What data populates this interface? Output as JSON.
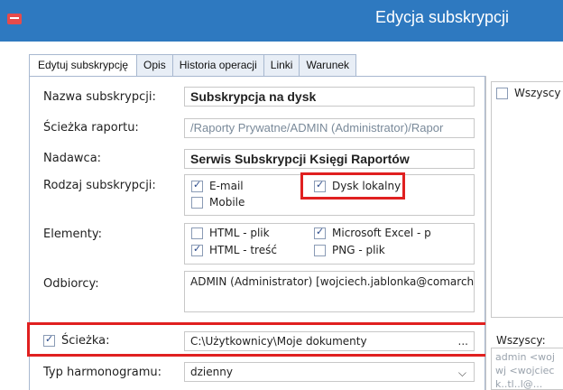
{
  "window": {
    "title": "Edycja subskrypcji"
  },
  "tabs": [
    {
      "label": "Edytuj subskrypcję"
    },
    {
      "label": "Opis"
    },
    {
      "label": "Historia operacji"
    },
    {
      "label": "Linki"
    },
    {
      "label": "Warunek"
    }
  ],
  "form": {
    "name_label": "Nazwa subskrypcji:",
    "name_value": "Subskrypcja na dysk",
    "path_label": "Ścieżka raportu:",
    "path_value": "/Raporty Prywatne/ADMIN (Administrator)/Rapor",
    "sender_label": "Nadawca:",
    "sender_value": "Serwis Subskrypcji Księgi Raportów",
    "type_label": "Rodzaj subskrypcji:",
    "type_options": [
      {
        "label": "E-mail",
        "checked": true
      },
      {
        "label": "Dysk lokalny",
        "checked": true
      },
      {
        "label": "Mobile",
        "checked": false
      }
    ],
    "elements_label": "Elementy:",
    "element_options": [
      {
        "label": "HTML - plik",
        "checked": false
      },
      {
        "label": "Microsoft Excel - p",
        "checked": true
      },
      {
        "label": "HTML - treść",
        "checked": true
      },
      {
        "label": "PNG - plik",
        "checked": false
      }
    ],
    "recipients_label": "Odbiorcy:",
    "recipients_value": "ADMIN (Administrator) [wojciech.jablonka@comarch.",
    "folder_label": "Ścieżka:",
    "folder_checked": true,
    "folder_value": "C:\\Użytkownicy\\Moje dokumenty",
    "folder_browse": "...",
    "schedule_label": "Typ harmonogramu:",
    "schedule_value": "dzienny"
  },
  "right_panel": {
    "all_top_label": "Wszyscy",
    "all_bottom_label": "Wszyscy:",
    "list_lines": [
      "admin <woj",
      "wj <wojciec",
      "k..tl..l@..."
    ]
  },
  "colors": {
    "titlebar": "#2e79c0",
    "highlight": "#e02020"
  }
}
